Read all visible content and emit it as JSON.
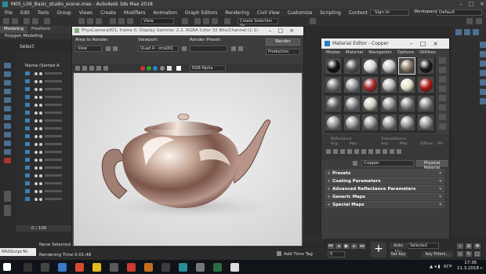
{
  "titlebar": {
    "title": "M05_L06_Basic_studio_scene.max - Autodesk 3ds Max 2018"
  },
  "menubar": {
    "items": [
      "File",
      "Edit",
      "Tools",
      "Group",
      "Views",
      "Create",
      "Modifiers",
      "Animation",
      "Graph Editors",
      "Rendering",
      "Civil View",
      "Customize",
      "Scripting",
      "Content"
    ]
  },
  "signin": "Sign In",
  "workspace": {
    "label": "Workspaces:",
    "value": "Default"
  },
  "toolbar": {
    "view": "View",
    "selection_set": "Create Selection Se"
  },
  "ribbon": {
    "tabs": [
      "Modeling",
      "Freeform"
    ],
    "sub": "Polygon Modeling"
  },
  "explorer": {
    "select_label": "Select",
    "column_header": "Name (Sorted A"
  },
  "timeline": {
    "frame": "0 / 100"
  },
  "status": {
    "maxscript": "MAXScript Mi",
    "selection": "None Selected",
    "render_time": "Rendering Time 0:01:48",
    "add_time_tag": "Add Time Tag"
  },
  "render_window": {
    "title": "PhysCamera001, frame 0, Display Gamma: 2.2, RGBA Color 32 Bits/Channel (1:1)",
    "area_label": "Area to Render:",
    "area_value": "View",
    "viewport_label": "Viewport:",
    "viewport_value": "Quad 4 - stra001",
    "preset_label": "Render Preset:",
    "preset_value": "",
    "render_button": "Render",
    "mode_value": "Production",
    "channel_value": "RGB Alpha",
    "channel_colors": [
      "#c83232",
      "#2e9e3a",
      "#3a7ec8",
      "#888888",
      "#ffffff"
    ]
  },
  "material_editor": {
    "title": "Material Editor - Copper",
    "menu": [
      "Modes",
      "Material",
      "Navigation",
      "Options",
      "Utilities"
    ],
    "material_name": "Copper",
    "material_type": "Physical Material",
    "labels_row1": [
      "Reflectance",
      "Transmittance"
    ],
    "labels_row2": [
      "Avg:",
      "Max:",
      "Avg:",
      "Max:",
      "Diffuse:",
      "0%"
    ],
    "rollouts": [
      "Presets",
      "Coating Parameters",
      "Advanced Reflectance Parameters",
      "Generic Maps",
      "Special Maps"
    ],
    "slot_colors": [
      [
        "#111111",
        "#5a5a5a",
        "#d8d8d8",
        "#c9c9c9",
        "#8a7a66",
        "#1a1a1a"
      ],
      [
        "#7a7a7a",
        "#9a9a9a",
        "#a82a2a",
        "#b8b8b8",
        "#e6dfc8",
        "#b01818"
      ],
      [
        "#6a6a6a",
        "#8c8c8c",
        "#cfcfbf",
        "#9c9c9c",
        "#8a8a8a",
        "#8a8a8a"
      ],
      [
        "#9a9a9a",
        "#9a9a9a",
        "#9a9a9a",
        "#9a9a9a",
        "#9a9a9a",
        "#9a9a9a"
      ]
    ]
  },
  "playback": {
    "auto_key": "Auto Key",
    "set_key": "Set Key",
    "selected": "Selected",
    "key_filters": "Key Filters...",
    "frame": "0"
  },
  "taskbar": {
    "lang": "БГР",
    "time": "17:36",
    "date": "11.3.2018 г."
  }
}
